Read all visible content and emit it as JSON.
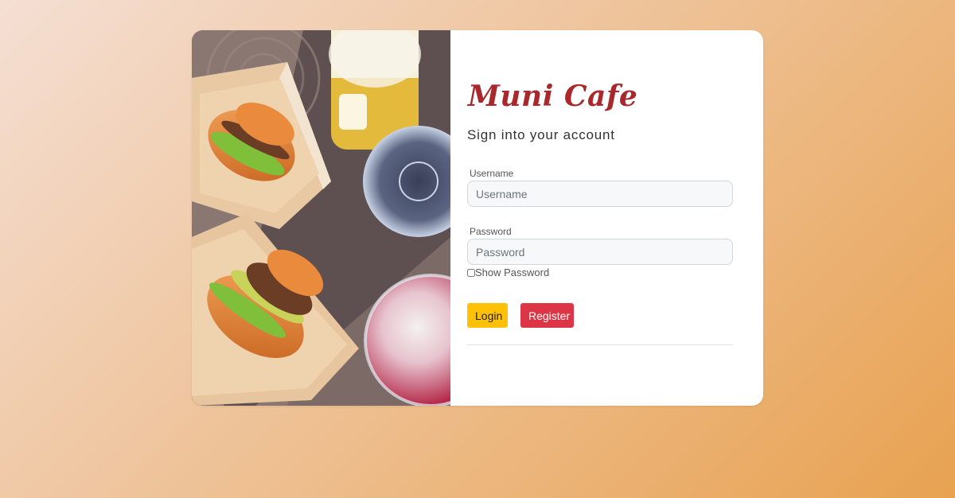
{
  "brand": {
    "name": "Muni Cafe",
    "color": "#a8282c"
  },
  "form": {
    "subtitle": "Sign into your account",
    "username": {
      "label": "Username",
      "placeholder": "Username",
      "value": ""
    },
    "password": {
      "label": "Password",
      "placeholder": "Password",
      "value": ""
    },
    "show_password_label": "Show Password",
    "show_password_checked": false
  },
  "buttons": {
    "login_label": "Login",
    "register_label": "Register",
    "login_color": "#ffc107",
    "register_color": "#dc3545"
  },
  "photo": {
    "description_icon": "food-photo"
  }
}
